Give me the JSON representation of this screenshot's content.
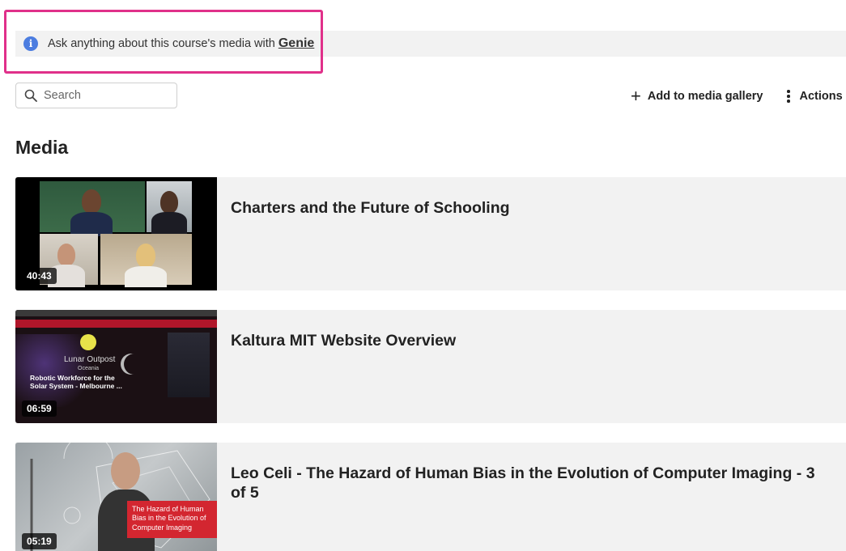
{
  "banner": {
    "text": "Ask anything about this course's media with",
    "link": "Genie"
  },
  "search": {
    "placeholder": "Search"
  },
  "toolbar": {
    "add_label": "Add to media gallery",
    "actions_label": "Actions"
  },
  "heading": "Media",
  "media": [
    {
      "title": "Charters and the Future of Schooling",
      "duration": "40:43"
    },
    {
      "title": "Kaltura MIT Website Overview",
      "duration": "06:59",
      "thumb_text": {
        "brand": "Lunar Outpost",
        "region": "Oceania",
        "caption_line1": "Robotic Workforce for the",
        "caption_line2": "Solar System - Melbourne ..."
      }
    },
    {
      "title": "Leo Celi - The Hazard of Human Bias in the Evolution of Computer Imaging - 3 of 5",
      "duration": "05:19",
      "thumb_text": {
        "caption_line1": "The Hazard of Human",
        "caption_line2": "Bias in the Evolution of",
        "caption_line3": "Computer Imaging"
      }
    }
  ],
  "colors": {
    "highlight": "#e0308a",
    "info_icon": "#4c7de0",
    "row_bg": "#f2f2f2",
    "thumb_caption_red": "#d32630"
  }
}
